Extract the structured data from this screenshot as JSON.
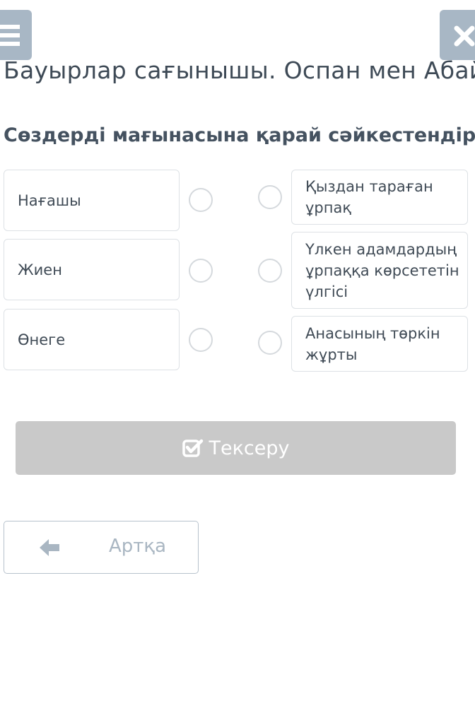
{
  "header": {
    "title": "Бауырлар сағынышы. Оспан мен Абай",
    "menu_icon": "hamburger-menu-icon",
    "close_icon": "close-x-icon"
  },
  "exercise": {
    "instruction": "Сөздерді мағынасына қарай сәйкестендір.",
    "left_items": [
      {
        "label": "Нағашы"
      },
      {
        "label": "Жиен"
      },
      {
        "label": "Өнеге"
      }
    ],
    "right_items": [
      {
        "label": "Қыздан тараған ұрпақ"
      },
      {
        "label": "Үлкен адамдардың ұрпаққа көрсететін үлгісі"
      },
      {
        "label": "Анасының төркін жұрты"
      }
    ]
  },
  "actions": {
    "check_label": "Тексеру",
    "check_icon": "checkbox-check-icon",
    "back_label": "Артқа",
    "back_icon": "arrow-left-icon"
  },
  "colors": {
    "header_button_bg": "#a8b7c5",
    "check_button_bg": "#c9c9c9",
    "text": "#3e4a56",
    "border": "#dde1e5"
  }
}
